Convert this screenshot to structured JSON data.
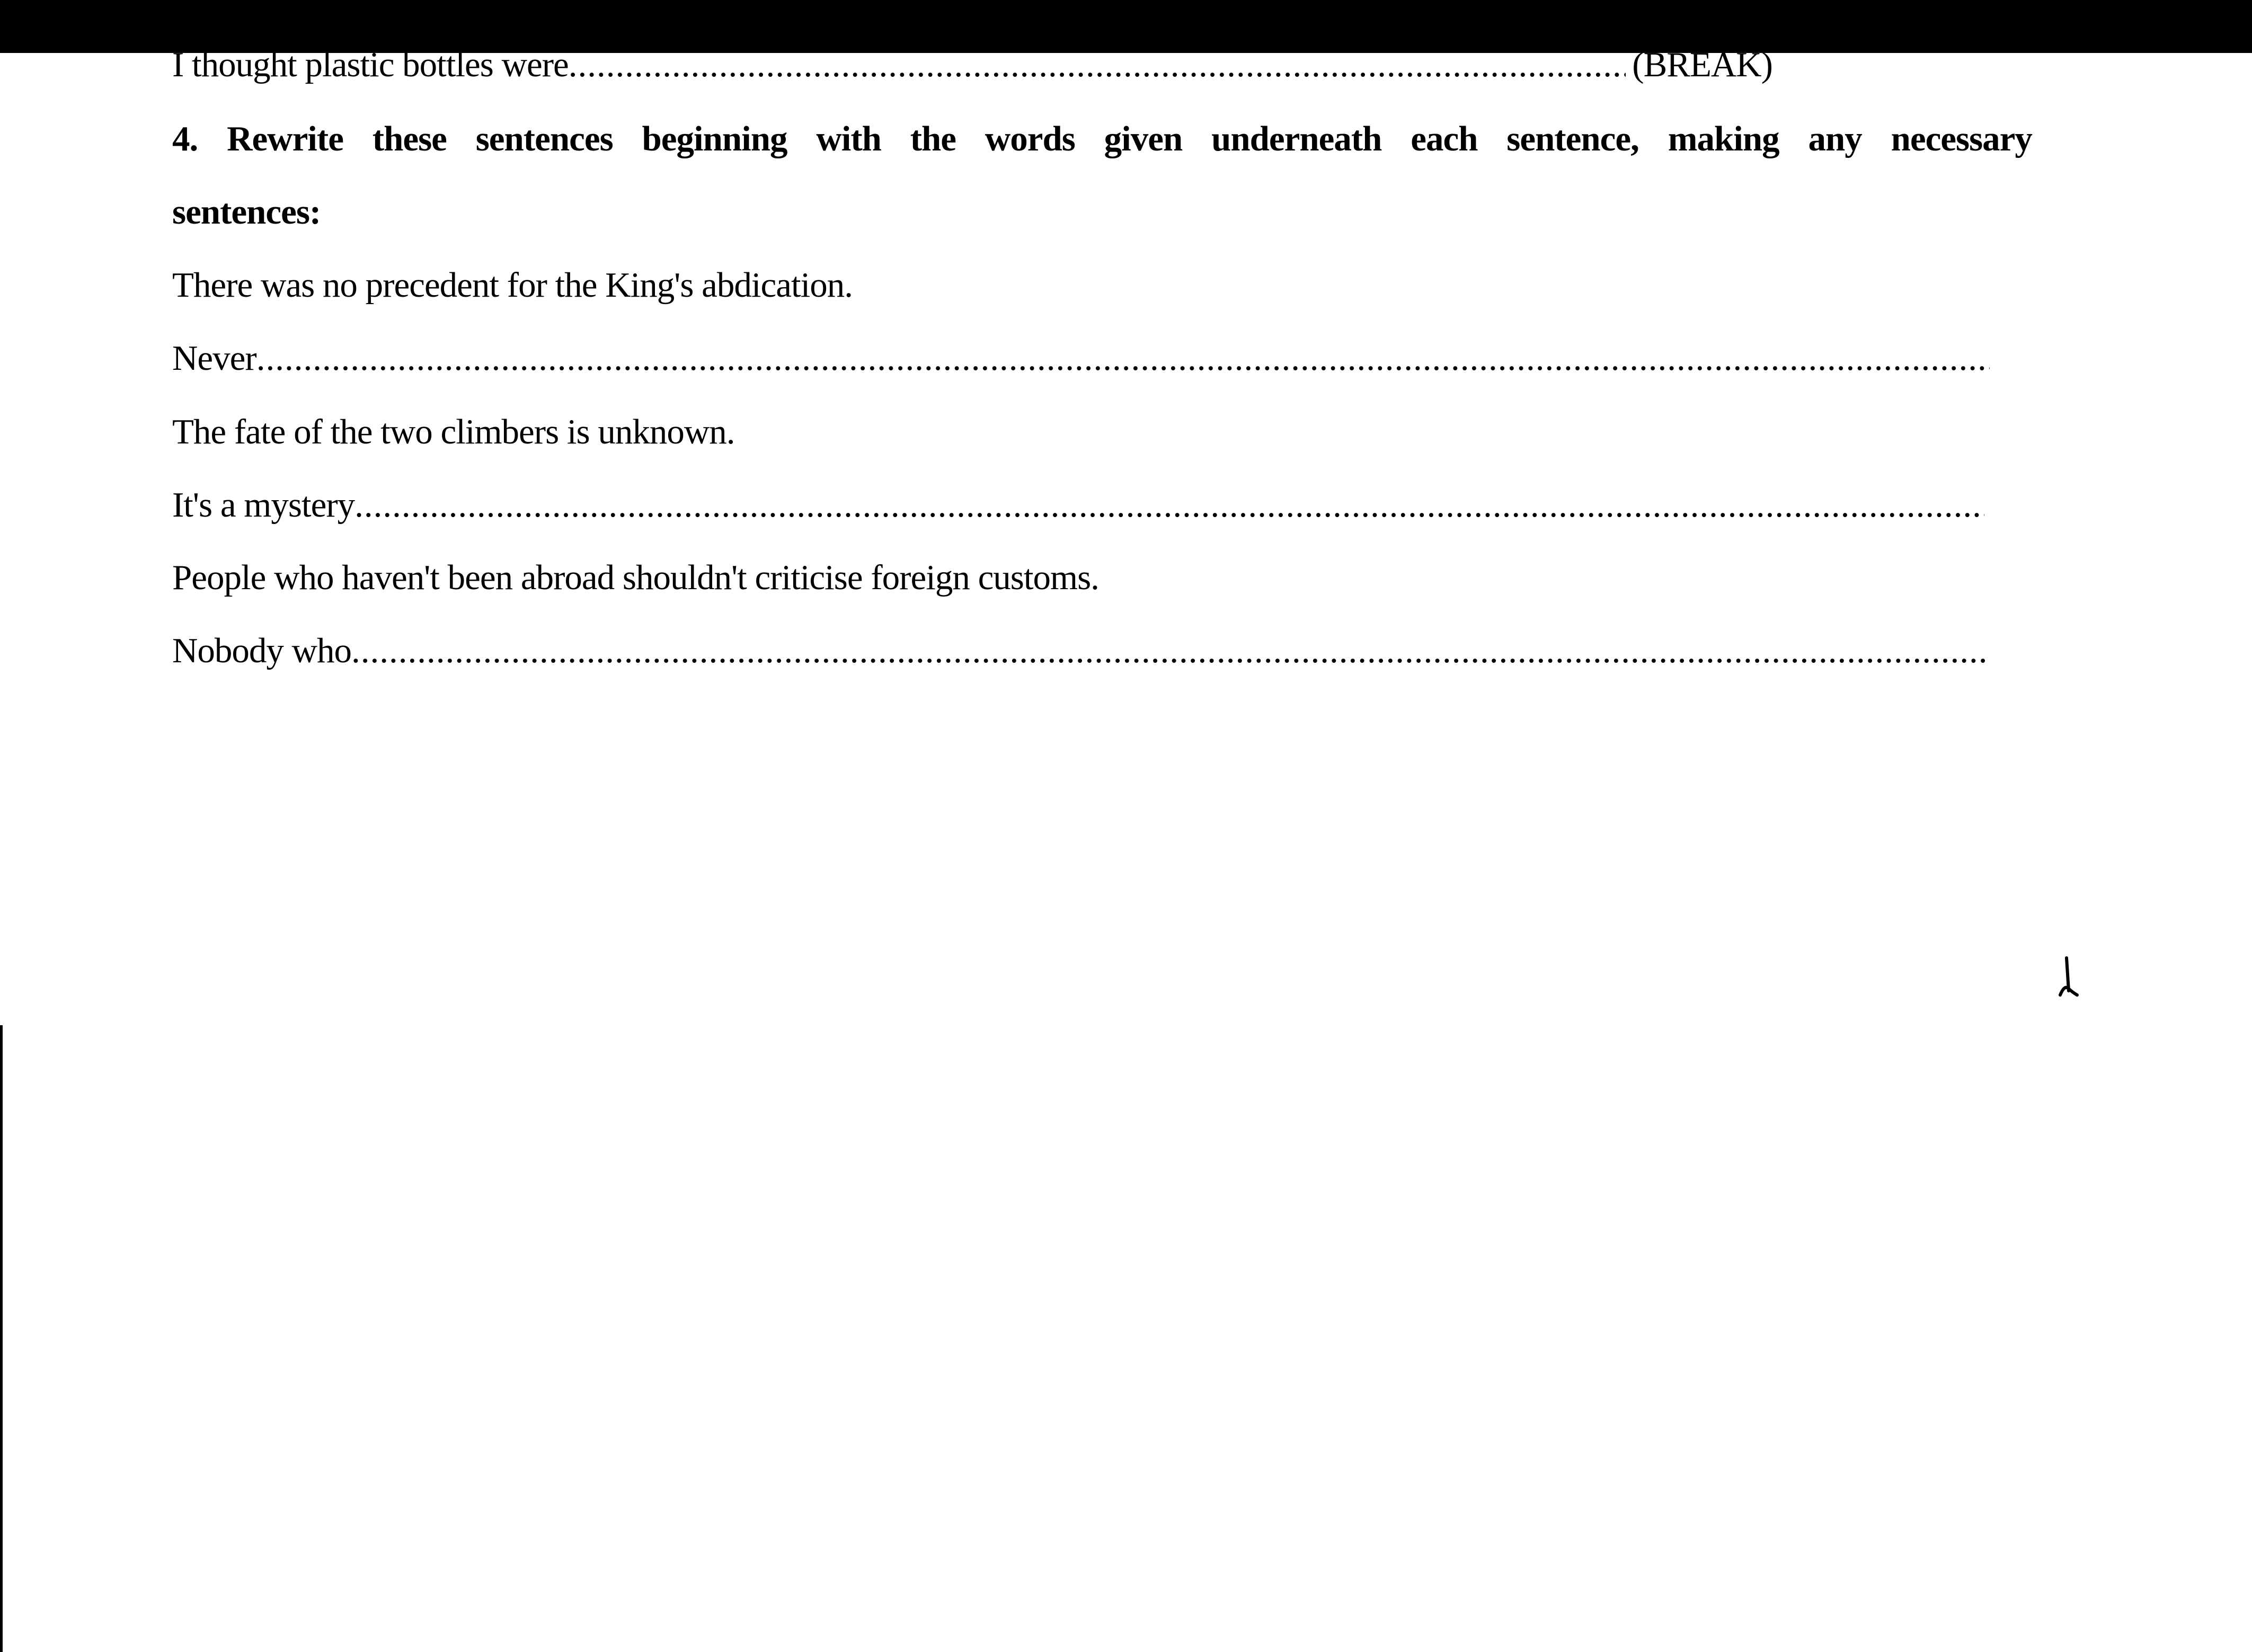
{
  "worksheet": {
    "prev_item": {
      "start": "I thought plastic bottles were",
      "end": "(BREAK)"
    },
    "section4": {
      "number": "4.",
      "words_line1": [
        "Rewrite",
        "these",
        "sentences",
        "beginning",
        "with",
        "the",
        "words",
        "given",
        "underneath",
        "each",
        "sentence,",
        "making",
        "any",
        "necessary"
      ],
      "line2": "sentences:"
    },
    "items": [
      {
        "sentence": "There was no precedent for the King's abdication.",
        "prompt": "Never"
      },
      {
        "sentence": "The fate of the two climbers is unknown.",
        "prompt": "It's a mystery"
      },
      {
        "sentence": "People who haven't been abroad shouldn't criticise foreign customs.",
        "prompt": "Nobody who"
      }
    ]
  }
}
